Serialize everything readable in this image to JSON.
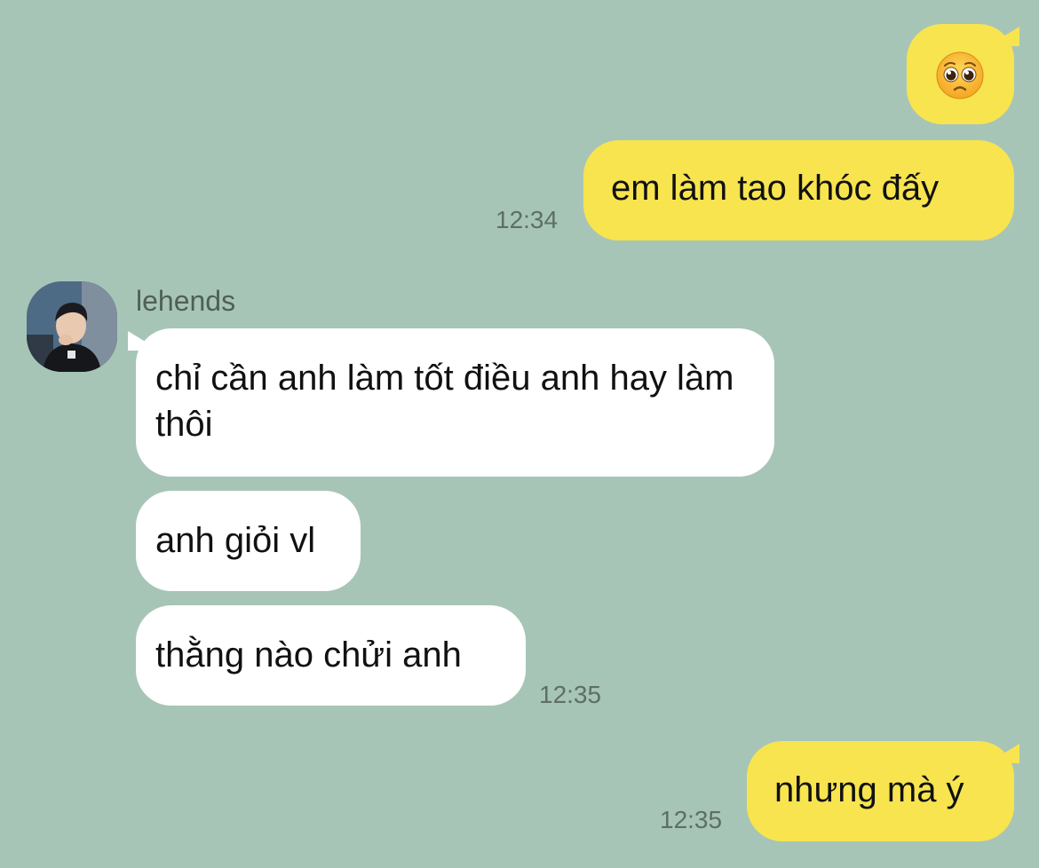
{
  "messages": [
    {
      "id": "msg-1",
      "direction": "outgoing",
      "type": "emoji",
      "emoji_name": "pleading-face-emoji"
    },
    {
      "id": "msg-2",
      "direction": "outgoing",
      "text": "em làm tao khóc đấy",
      "time": "12:34"
    },
    {
      "id": "msg-3",
      "direction": "incoming",
      "text": "chỉ cần anh làm tốt điều anh hay làm thôi"
    },
    {
      "id": "msg-4",
      "direction": "incoming",
      "text": "anh giỏi vl"
    },
    {
      "id": "msg-5",
      "direction": "incoming",
      "text": "thằng nào chửi anh",
      "time": "12:35"
    },
    {
      "id": "msg-6",
      "direction": "outgoing",
      "text": "nhưng mà ý",
      "time": "12:35"
    }
  ],
  "sender": {
    "name": "lehends"
  },
  "colors": {
    "background": "#a7c5b7",
    "outgoing_bubble": "#f7e44f",
    "incoming_bubble": "#ffffff",
    "timestamp": "#5e6e67"
  }
}
